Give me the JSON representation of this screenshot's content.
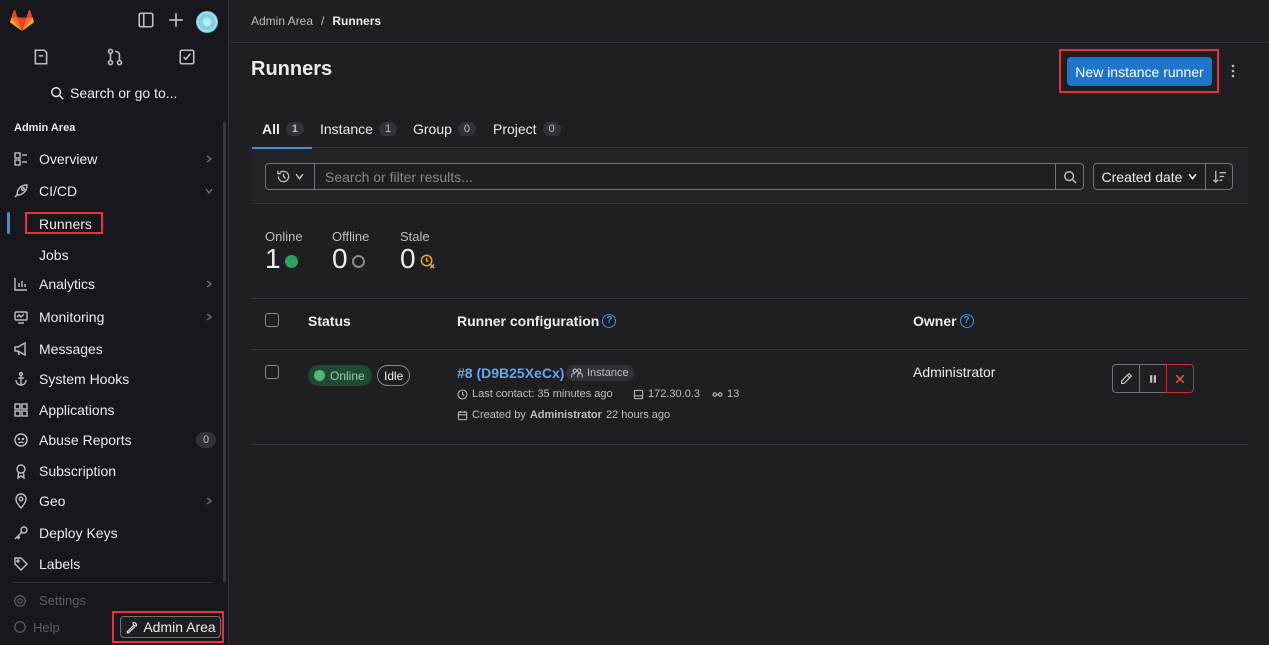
{
  "sidebar": {
    "search_label": "Search or go to...",
    "section_title": "Admin Area",
    "items": [
      {
        "label": "Overview",
        "icon": "overview-icon"
      },
      {
        "label": "CI/CD",
        "icon": "rocket-icon"
      },
      {
        "label": "Runners"
      },
      {
        "label": "Jobs"
      },
      {
        "label": "Analytics",
        "icon": "chart-icon"
      },
      {
        "label": "Monitoring",
        "icon": "monitor-icon"
      },
      {
        "label": "Messages",
        "icon": "bullhorn-icon"
      },
      {
        "label": "System Hooks",
        "icon": "anchor-icon"
      },
      {
        "label": "Applications",
        "icon": "applications-icon"
      },
      {
        "label": "Abuse Reports",
        "icon": "slight-frown-icon",
        "count": "0"
      },
      {
        "label": "Subscription",
        "icon": "license-icon"
      },
      {
        "label": "Geo",
        "icon": "location-icon"
      },
      {
        "label": "Deploy Keys",
        "icon": "key-icon"
      },
      {
        "label": "Labels",
        "icon": "label-icon"
      }
    ],
    "settings_label": "Settings",
    "help_label": "Help",
    "admin_button_label": "Admin Area"
  },
  "breadcrumb": {
    "parent": "Admin Area",
    "sep": "/",
    "current": "Runners"
  },
  "page": {
    "title": "Runners",
    "new_runner_label": "New instance runner"
  },
  "tabs": [
    {
      "label": "All",
      "count": "1"
    },
    {
      "label": "Instance",
      "count": "1"
    },
    {
      "label": "Group",
      "count": "0"
    },
    {
      "label": "Project",
      "count": "0"
    }
  ],
  "filter": {
    "placeholder": "Search or filter results...",
    "sort_label": "Created date"
  },
  "stats": [
    {
      "label": "Online",
      "value": "1"
    },
    {
      "label": "Offline",
      "value": "0"
    },
    {
      "label": "Stale",
      "value": "0"
    }
  ],
  "table": {
    "headers": {
      "status": "Status",
      "config": "Runner configuration",
      "owner": "Owner"
    },
    "rows": [
      {
        "status": "Online",
        "state": "Idle",
        "runner_id": "#8 (D9B25XeCx)",
        "type": "Instance",
        "last_contact": "Last contact: 35 minutes ago",
        "ip": "172.30.0.3",
        "jobs": "13",
        "created_prefix": "Created by",
        "created_by": "Administrator",
        "created_ago": "22 hours ago",
        "owner": "Administrator"
      }
    ]
  },
  "colors": {
    "accent": "#1f75cb",
    "online": "#2da160",
    "danger": "#ec5941",
    "highlight_box": "#e5333b"
  }
}
